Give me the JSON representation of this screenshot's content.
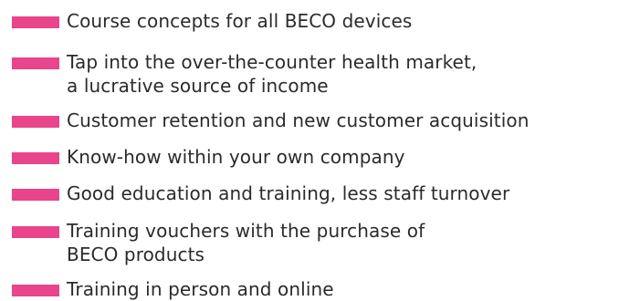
{
  "accent_color": "#e8458b",
  "items": [
    {
      "lines": [
        "Course concepts for all BECO devices"
      ]
    },
    {
      "lines": [
        "Tap into the over-the-counter health market,",
        "a lucrative source of income"
      ]
    },
    {
      "lines": [
        "Customer retention and new customer acquisition"
      ]
    },
    {
      "lines": [
        "Know-how within your own company"
      ]
    },
    {
      "lines": [
        "Good education and training, less staff turnover"
      ]
    },
    {
      "lines": [
        "Training vouchers with the purchase of",
        "BECO products"
      ]
    },
    {
      "lines": [
        "Training in person and online"
      ]
    }
  ]
}
